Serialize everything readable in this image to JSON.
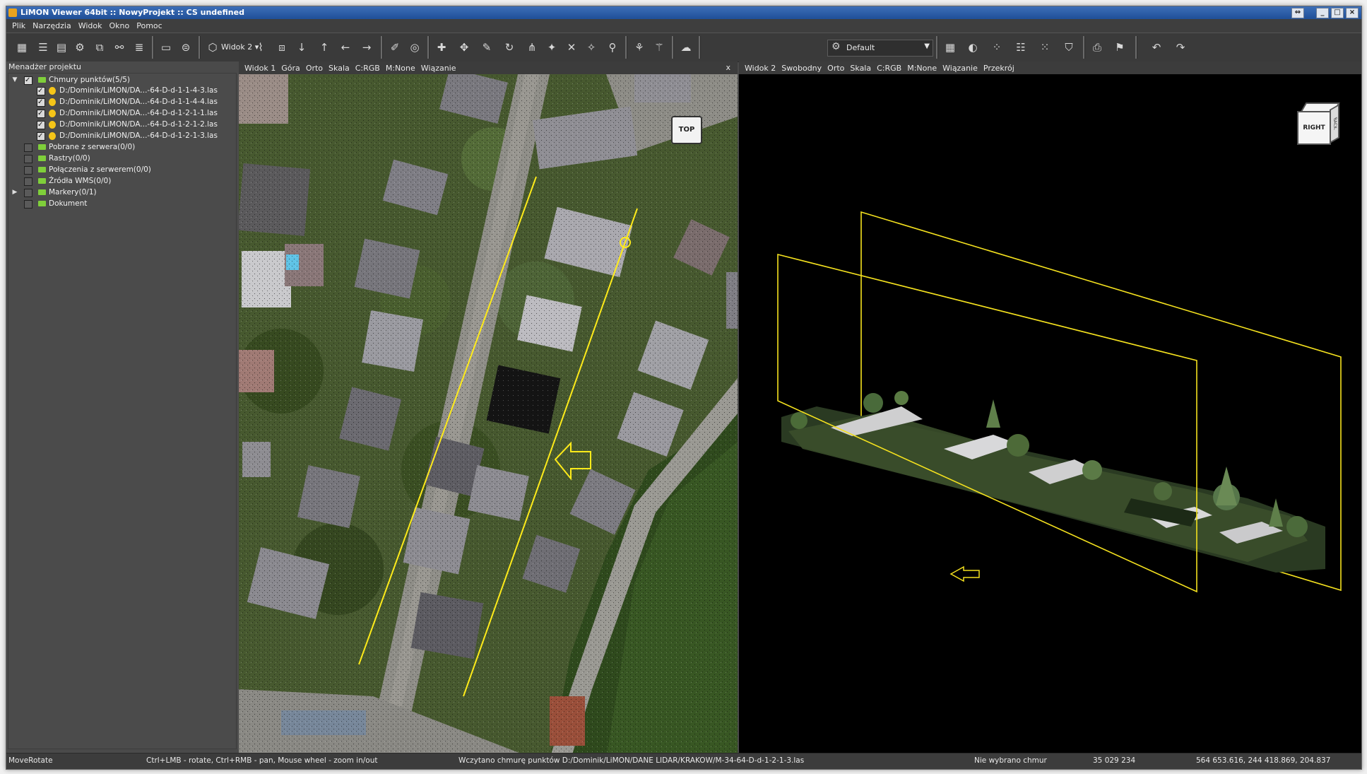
{
  "window": {
    "title": "LiMON Viewer 64bit :: NowyProjekt :: CS undefined",
    "buttons": {
      "restore_icon": "⇔",
      "minimize": "_",
      "maximize": "□",
      "close": "×"
    }
  },
  "menu": [
    "Plik",
    "Narzędzia",
    "Widok",
    "Okno",
    "Pomoc"
  ],
  "toolbar": {
    "view_select": "Widok 2",
    "profile_select": "Default"
  },
  "project_manager": {
    "header": "Menadżer projektu",
    "root": "Chmury punktów(5/5)",
    "clouds": [
      "D:/Dominik/LiMON/DA...-64-D-d-1-1-4-3.las",
      "D:/Dominik/LiMON/DA...-64-D-d-1-1-4-4.las",
      "D:/Dominik/LiMON/DA...-64-D-d-1-2-1-1.las",
      "D:/Dominik/LiMON/DA...-64-D-d-1-2-1-2.las",
      "D:/Dominik/LiMON/DA...-64-D-d-1-2-1-3.las"
    ],
    "others": [
      "Pobrane z serwera(0/0)",
      "Rastry(0/0)",
      "Połączenia z serwerem(0/0)",
      "Źródła WMS(0/0)",
      "Markery(0/1)",
      "Dokument"
    ]
  },
  "view1": {
    "tabs": [
      "Widok 1",
      "Góra",
      "Orto",
      "Skala",
      "C:RGB",
      "M:None",
      "Wiązanie"
    ],
    "close": "x",
    "badge": "TOP"
  },
  "view2": {
    "tabs": [
      "Widok 2",
      "Swobodny",
      "Orto",
      "Skala",
      "C:RGB",
      "M:None",
      "Wiązanie",
      "Przekrój"
    ],
    "cube_label": "RIGHT",
    "cube_side": "BACK"
  },
  "status": {
    "mode": "MoveRotate",
    "hint": "Ctrl+LMB - rotate, Ctrl+RMB - pan, Mouse wheel - zoom in/out",
    "message": "Wczytano chmurę punktów D:/Dominik/LiMON/DANE LIDAR/KRAKOW/M-34-64-D-d-1-2-1-3.las",
    "selection": "Nie wybrano chmur",
    "count": "35 029 234",
    "coords": "564 653.616, 244 418.869, 204.837"
  }
}
